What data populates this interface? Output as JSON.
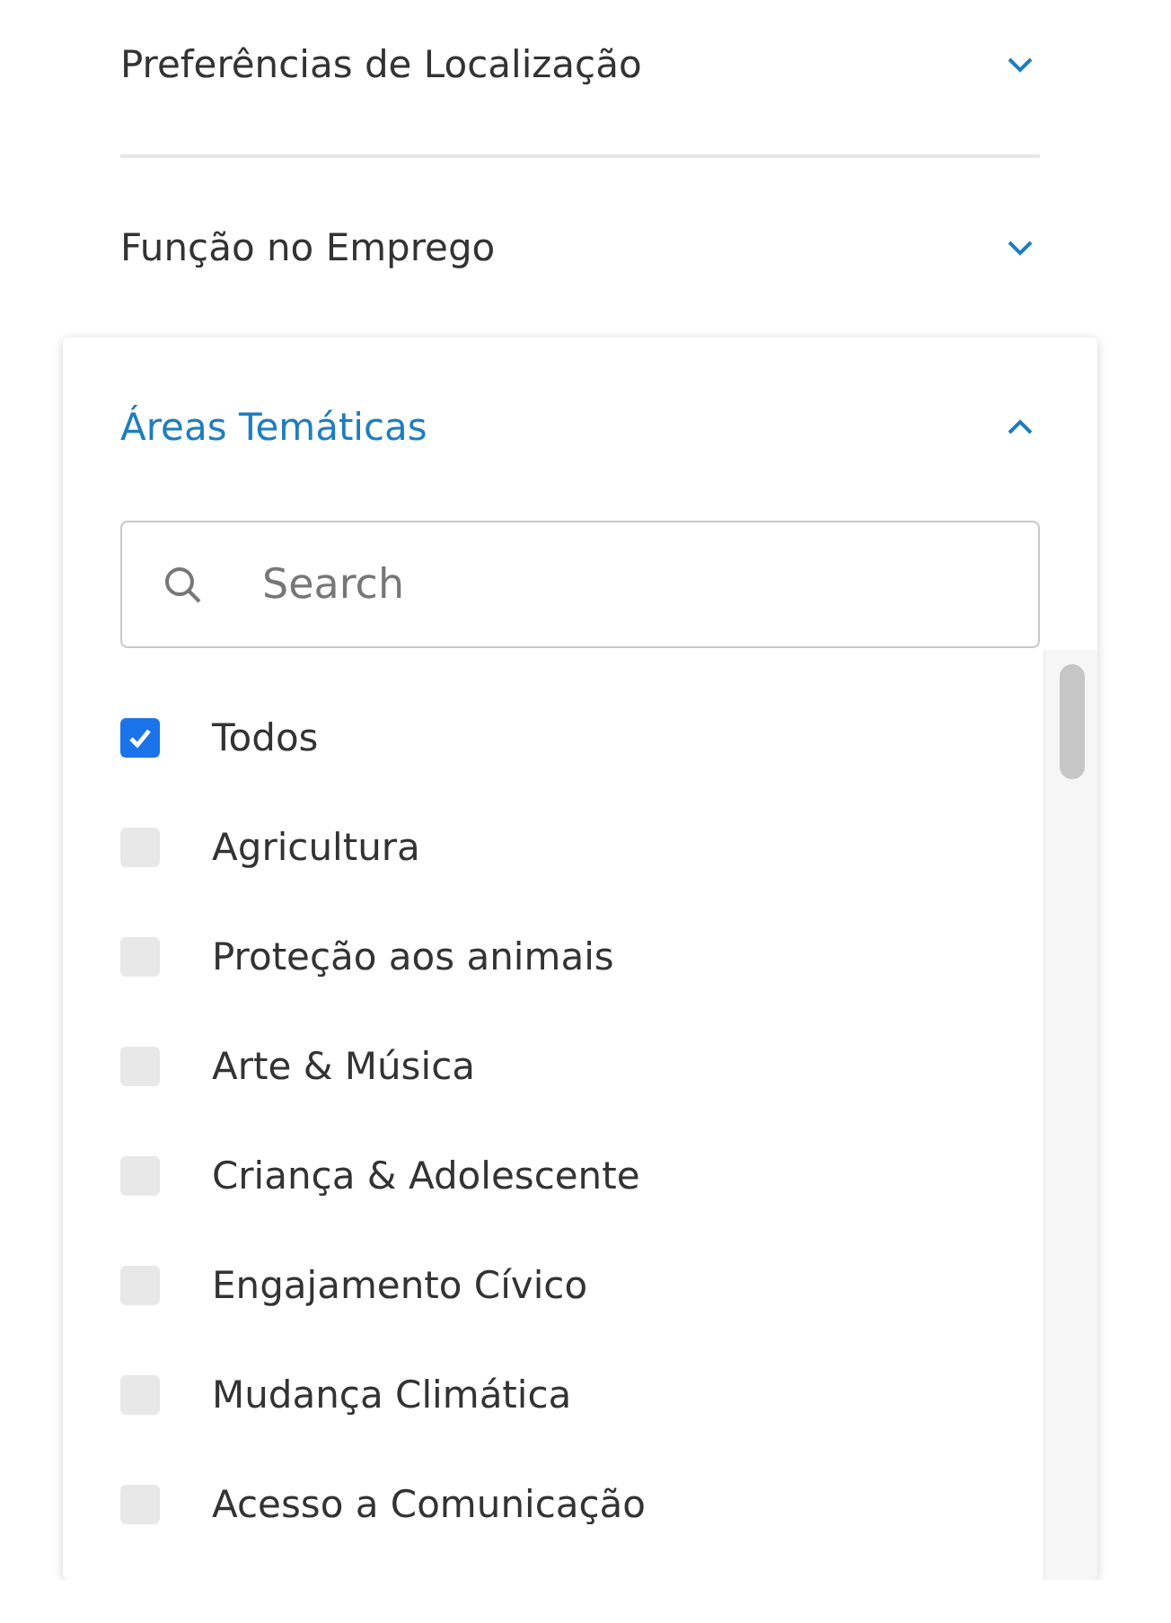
{
  "sections": [
    {
      "title": "Preferências de Localização",
      "expanded": false
    },
    {
      "title": "Função no Emprego",
      "expanded": false
    },
    {
      "title": "Áreas Temáticas",
      "expanded": true,
      "search": {
        "placeholder": "Search"
      },
      "options": [
        {
          "label": "Todos",
          "checked": true
        },
        {
          "label": "Agricultura",
          "checked": false
        },
        {
          "label": "Proteção aos animais",
          "checked": false
        },
        {
          "label": "Arte & Música",
          "checked": false
        },
        {
          "label": "Criança & Adolescente",
          "checked": false
        },
        {
          "label": "Engajamento Cívico",
          "checked": false
        },
        {
          "label": "Mudança Climática",
          "checked": false
        },
        {
          "label": "Acesso a Comunicação",
          "checked": false
        }
      ]
    }
  ]
}
